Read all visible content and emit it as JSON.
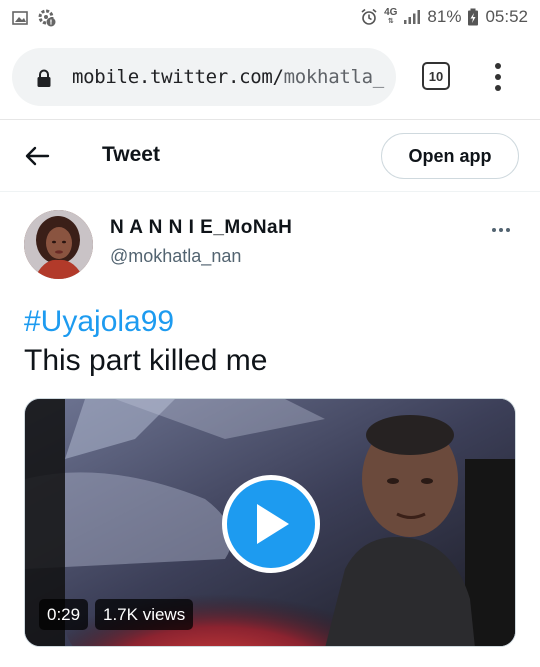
{
  "status_bar": {
    "network": "4G",
    "battery": "81%",
    "time": "05:52"
  },
  "browser": {
    "url_host": "mobile.twitter.com/",
    "url_path": "mokhatla_",
    "tab_count": "10"
  },
  "header": {
    "title": "Tweet",
    "open_app_label": "Open app"
  },
  "tweet": {
    "display_name": "N A N N I E_MoNaH",
    "handle": "@mokhatla_nan",
    "hashtag": "#Uyajola99",
    "text": "This part killed me",
    "video_duration": "0:29",
    "video_views": "1.7K views"
  },
  "colors": {
    "accent": "#1d9bf0",
    "text_primary": "#0f1419",
    "text_secondary": "#536471"
  }
}
